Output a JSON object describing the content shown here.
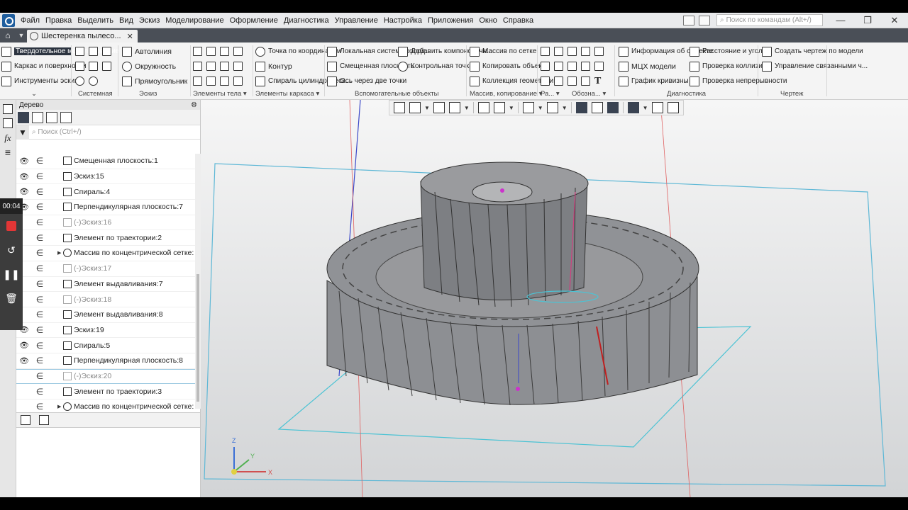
{
  "menu": {
    "items": [
      "Файл",
      "Правка",
      "Выделить",
      "Вид",
      "Эскиз",
      "Моделирование",
      "Оформление",
      "Диагностика",
      "Управление",
      "Настройка",
      "Приложения",
      "Окно",
      "Справка"
    ],
    "search_placeholder": "Поиск по командам (Alt+/)"
  },
  "tabs": {
    "document": "Шестеренка пылесо..."
  },
  "ribbon": {
    "modes": [
      "Твердотельное моделирование",
      "Каркас и поверхности",
      "Инструменты эскиза"
    ],
    "groups": [
      "Системная",
      "Эскиз",
      "Элементы тела",
      "Элементы каркаса",
      "Вспомогательные объекты",
      "Массив, копирование",
      "Ра...",
      "Обозна...",
      "Диагностика",
      "Чертеж"
    ],
    "sketch_tools": [
      "Автолиния",
      "Окружность",
      "Прямоугольник"
    ],
    "frame_tools": [
      "Точка по координатам",
      "Контур",
      "Спираль цилиндрическ..."
    ],
    "aux_col1": [
      "Локальная система коорд...",
      "Смещенная плоскость",
      "Ось через две точки"
    ],
    "aux_col2": [
      "Добавить компоновочн...",
      "Контрольная точка"
    ],
    "array_tools": [
      "Массив по сетке",
      "Копировать объекты",
      "Коллекция геометрии"
    ],
    "diag_col1": [
      "Информация об объекте",
      "МЦХ модели",
      "График кривизны"
    ],
    "diag_col2": [
      "Расстояние и угол",
      "Проверка коллизий",
      "Проверка непрерывности"
    ],
    "drawing_tools": [
      "Создать чертеж по модели",
      "Управление связанными ч..."
    ]
  },
  "tree": {
    "title": "Дерево",
    "search_placeholder": "Поиск (Ctrl+/)",
    "rows": [
      {
        "label": "Смещенная плоскость:1",
        "visible": true,
        "dim": false,
        "expandable": false
      },
      {
        "label": "Эскиз:15",
        "visible": true,
        "dim": false,
        "expandable": false
      },
      {
        "label": "Спираль:4",
        "visible": true,
        "dim": false,
        "expandable": false
      },
      {
        "label": "Перпендикулярная плоскость:7",
        "visible": true,
        "dim": false,
        "expandable": false
      },
      {
        "label": "(-)Эскиз:16",
        "visible": false,
        "dim": true,
        "expandable": false
      },
      {
        "label": "Элемент по траектории:2",
        "visible": false,
        "dim": false,
        "expandable": false
      },
      {
        "label": "Массив по концентрической сетке:",
        "visible": false,
        "dim": false,
        "expandable": true
      },
      {
        "label": "(-)Эскиз:17",
        "visible": false,
        "dim": true,
        "expandable": false
      },
      {
        "label": "Элемент выдавливания:7",
        "visible": false,
        "dim": false,
        "expandable": false
      },
      {
        "label": "(-)Эскиз:18",
        "visible": false,
        "dim": true,
        "expandable": false
      },
      {
        "label": "Элемент выдавливания:8",
        "visible": false,
        "dim": false,
        "expandable": false
      },
      {
        "label": "Эскиз:19",
        "visible": true,
        "dim": false,
        "expandable": false
      },
      {
        "label": "Спираль:5",
        "visible": true,
        "dim": false,
        "expandable": false
      },
      {
        "label": "Перпендикулярная плоскость:8",
        "visible": true,
        "dim": false,
        "expandable": false
      },
      {
        "label": "(-)Эскиз:20",
        "visible": false,
        "dim": true,
        "expandable": false
      },
      {
        "label": "Элемент по траектории:3",
        "visible": false,
        "dim": false,
        "expandable": false
      },
      {
        "label": "Массив по концентрической сетке:",
        "visible": false,
        "dim": false,
        "expandable": true
      }
    ]
  },
  "recorder": {
    "time": "00:04"
  },
  "axes": {
    "x": "X",
    "y": "Y",
    "z": "Z"
  }
}
